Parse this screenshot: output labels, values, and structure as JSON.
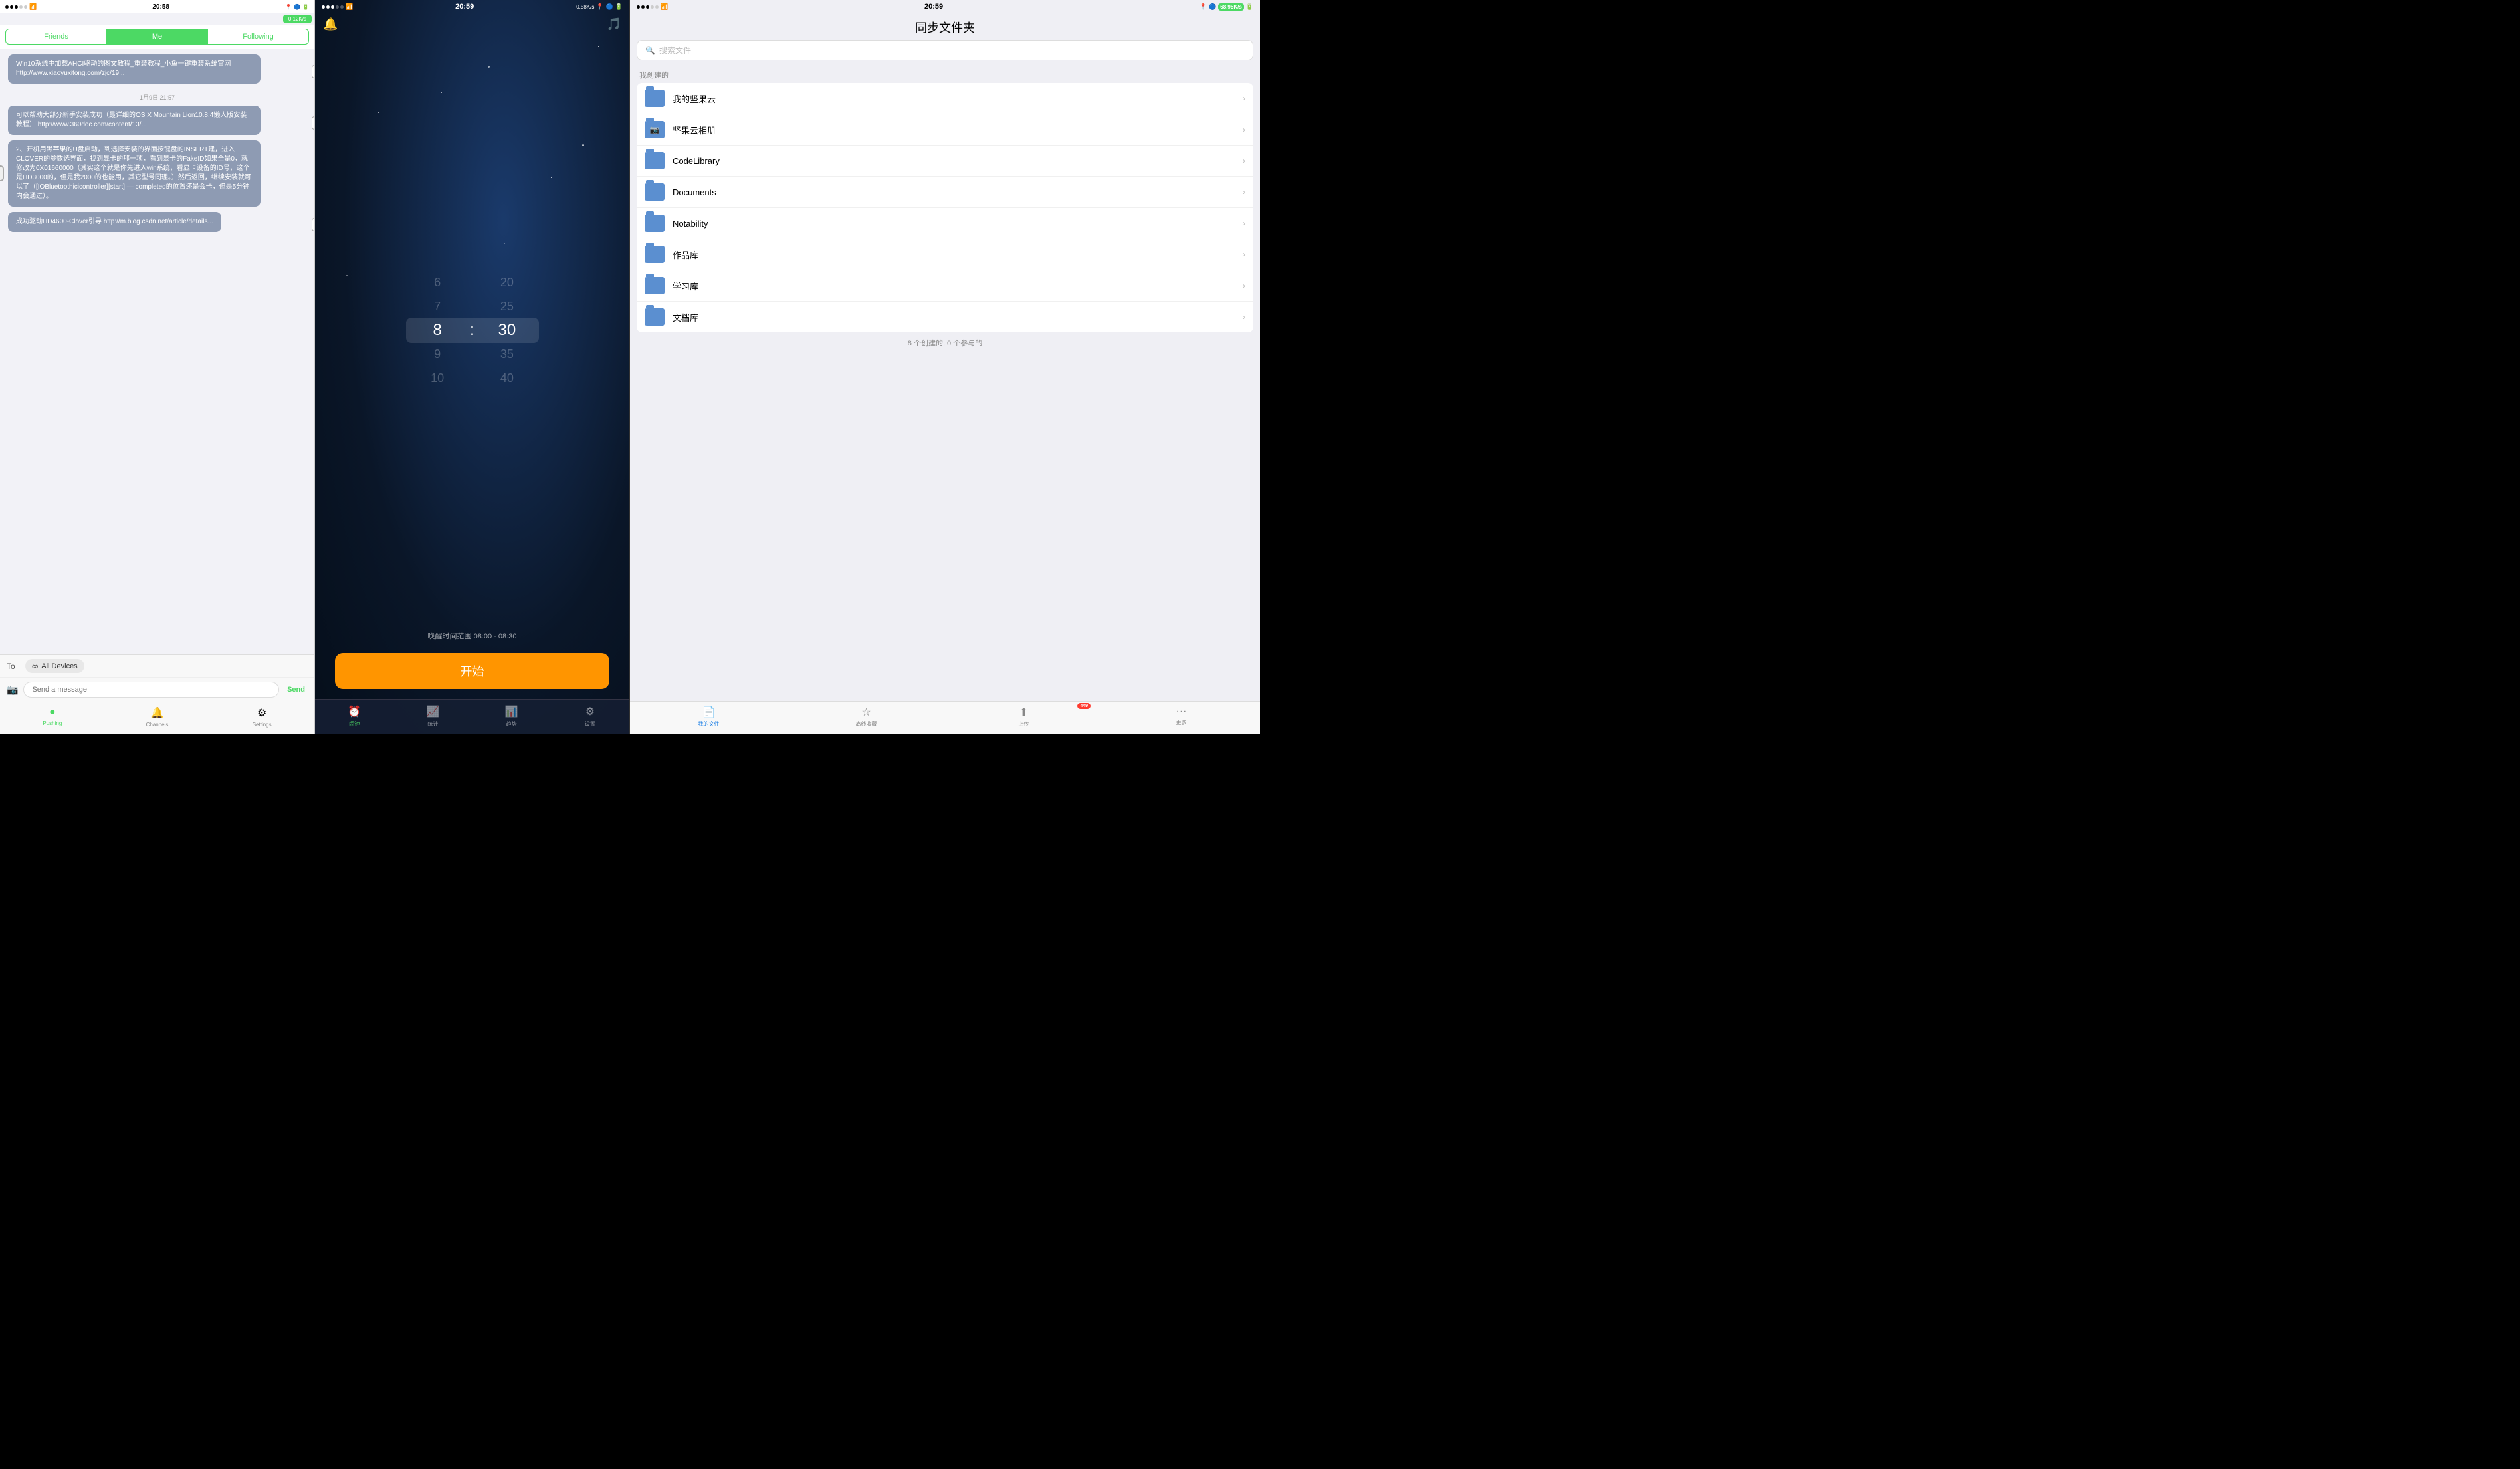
{
  "panel1": {
    "status": {
      "time": "20:58",
      "speed": "0.12K/s"
    },
    "tabs": [
      {
        "label": "Friends",
        "active": false
      },
      {
        "label": "Me",
        "active": true
      },
      {
        "label": "Following",
        "active": false
      }
    ],
    "messages": [
      {
        "id": 1,
        "text": "Win10系统中加载AHCI驱动的图文教程_重装教程_小鱼一键重装系统官网\nhttp://www.xiaoyuxitong.com/zjc/19...",
        "has_share": true
      },
      {
        "id": 2,
        "date": "1月9日 21:57"
      },
      {
        "id": 3,
        "text": "可以帮助大部分新手安装成功（最详细的OS X Mountain Lion10.8.4懒人版安装教程）\nhttp://www.360doc.com/content/13/...",
        "has_share": true
      },
      {
        "id": 4,
        "text": "2、开机用黑苹果的U盘启动，到选择安装的界面按键盘的INSERT建，进入CLOVER的参数选界面，找到显卡的那一项，看到显卡的FakeID如果全是0，就修改为0X01660000（其实这个就是你先进入win系统，看显卡设备的ID号，这个是HD3000的，但是我2000的也能用，其它型号同理。）然后返回，继续安装就可以了（[IOBluetoothicicontroller][start] — completed的位置还是会卡，但是5分钟内会通过）。",
        "has_share": false
      },
      {
        "id": 5,
        "text": "成功驱动HD4600-Clover引导\nhttp://m.blog.csdn.net/article/details...",
        "has_share": true
      }
    ],
    "compose": {
      "to_label": "To",
      "device": "All Devices",
      "placeholder": "Send a message",
      "send": "Send"
    },
    "bottom_nav": [
      {
        "label": "Pushing",
        "active": true,
        "icon": "●"
      },
      {
        "label": "Channels",
        "active": false,
        "icon": "🔔"
      },
      {
        "label": "Settings",
        "active": false,
        "icon": "⚙"
      }
    ]
  },
  "panel2": {
    "status": {
      "time": "20:59",
      "speed": "0.58K/s"
    },
    "top_icons": {
      "bell": "🔔",
      "music": "🎵"
    },
    "time_picker": {
      "hours": [
        "6",
        "7",
        "8",
        "9",
        "10"
      ],
      "minutes": [
        "20",
        "25",
        "30",
        "35",
        "40"
      ],
      "selected_hour": "8",
      "selected_minute": "30",
      "separator": ":"
    },
    "wake_range": "唤醒时间范围 08:00 - 08:30",
    "start_button": "开始",
    "bottom_nav": [
      {
        "label": "闹钟",
        "active": true,
        "icon": "⏰"
      },
      {
        "label": "统计",
        "active": false,
        "icon": "📈"
      },
      {
        "label": "趋势",
        "active": false,
        "icon": "📊"
      },
      {
        "label": "设置",
        "active": false,
        "icon": "⚙"
      }
    ]
  },
  "panel3": {
    "status": {
      "time": "20:59",
      "speed": "68.95K/s"
    },
    "title": "同步文件夹",
    "search_placeholder": "搜索文件",
    "section_label": "我创建的",
    "folders": [
      {
        "name": "我的坚果云",
        "type": "folder"
      },
      {
        "name": "坚果云相册",
        "type": "camera"
      },
      {
        "name": "CodeLibrary",
        "type": "folder"
      },
      {
        "name": "Documents",
        "type": "folder"
      },
      {
        "name": "Notability",
        "type": "folder"
      },
      {
        "name": "作品库",
        "type": "folder"
      },
      {
        "name": "学习库",
        "type": "folder"
      },
      {
        "name": "文档库",
        "type": "folder"
      }
    ],
    "footer": "8 个创建的, 0 个参与的",
    "bottom_nav": [
      {
        "label": "我的文件",
        "active": true,
        "icon": "📄"
      },
      {
        "label": "离线收藏",
        "active": false,
        "icon": "☆"
      },
      {
        "label": "上传",
        "active": false,
        "icon": "⬆",
        "badge": "449"
      },
      {
        "label": "更多",
        "active": false,
        "icon": "···"
      }
    ]
  }
}
